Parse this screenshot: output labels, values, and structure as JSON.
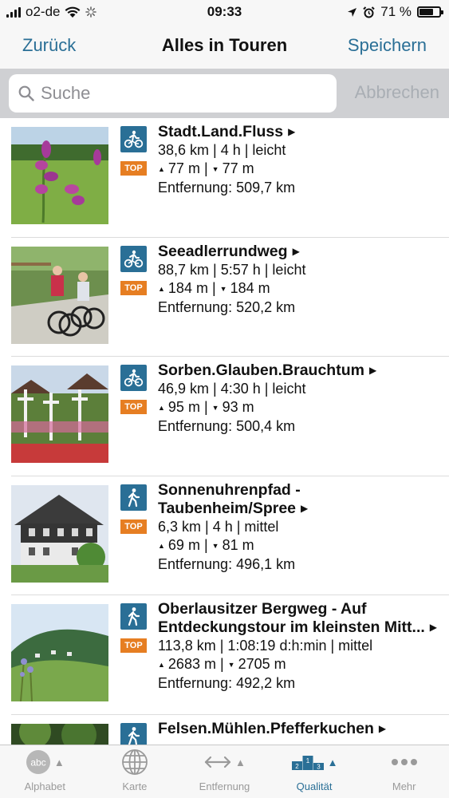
{
  "status_bar": {
    "carrier": "o2-de",
    "time": "09:33",
    "battery_percent": "71 %",
    "battery_level": 0.71
  },
  "nav": {
    "back_label": "Zurück",
    "title": "Alles in Touren",
    "save_label": "Speichern"
  },
  "search": {
    "placeholder": "Suche",
    "value": "",
    "cancel_label": "Abbrechen"
  },
  "tours": [
    {
      "title": "Stadt.Land.Fluss",
      "type": "bike-icon",
      "top": "TOP",
      "stats": "38,6 km | 4 h | leicht",
      "ascent": "77 m",
      "descent": "77 m",
      "distance": "Entfernung: 509,7 km"
    },
    {
      "title": "Seeadlerrundweg",
      "type": "bike-icon",
      "top": "TOP",
      "stats": "88,7 km | 5:57 h | leicht",
      "ascent": "184 m",
      "descent": "184 m",
      "distance": "Entfernung: 520,2 km"
    },
    {
      "title": "Sorben.Glauben.Brauchtum",
      "type": "bike-icon",
      "top": "TOP",
      "stats": "46,9 km | 4:30 h | leicht",
      "ascent": "95 m",
      "descent": "93 m",
      "distance": "Entfernung: 500,4 km"
    },
    {
      "title": "Sonnenuhrenpfad - Taubenheim/Spree",
      "type": "hiking-icon",
      "top": "TOP",
      "stats": "6,3 km | 4 h | mittel",
      "ascent": "69 m",
      "descent": "81 m",
      "distance": "Entfernung: 496,1 km"
    },
    {
      "title": "Oberlausitzer Bergweg - Auf Entdeckungstour im kleinsten Mitt...",
      "type": "hiking-icon",
      "top": "TOP",
      "stats": "113,8 km | 1:08:19 d:h:min | mittel",
      "ascent": "2683 m",
      "descent": "2705 m",
      "distance": "Entfernung: 492,2 km"
    },
    {
      "title": "Felsen.Mühlen.Pfefferkuchen",
      "type": "hiking-icon",
      "top": "",
      "stats": "",
      "ascent": "",
      "descent": "",
      "distance": ""
    }
  ],
  "tabs": [
    {
      "label": "Alphabet",
      "icon": "abc-icon",
      "active": false
    },
    {
      "label": "Karte",
      "icon": "globe-icon",
      "active": false
    },
    {
      "label": "Entfernung",
      "icon": "distance-icon",
      "active": false
    },
    {
      "label": "Qualität",
      "icon": "podium-icon",
      "active": true
    },
    {
      "label": "Mehr",
      "icon": "more-icon",
      "active": false
    }
  ],
  "colors": {
    "accent": "#2a6f96",
    "top_badge": "#e67e22",
    "bar_background": "#f7f7f7",
    "search_background": "#cfd0d3"
  }
}
